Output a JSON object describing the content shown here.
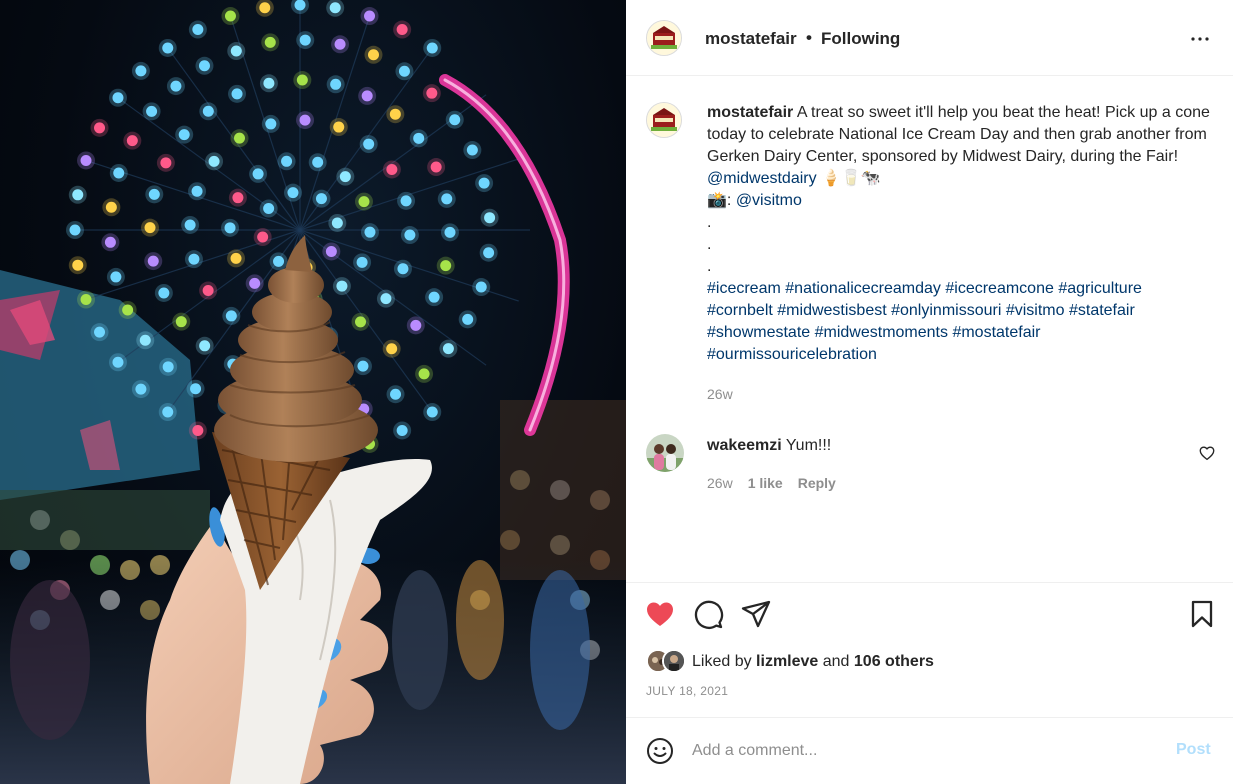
{
  "post": {
    "username": "mostatefair",
    "header_separator": "•",
    "follow_status": "Following",
    "logo_text": "MISSOURI STATE FAIR"
  },
  "caption": {
    "username": "mostatefair",
    "text_1": " A treat so sweet it'll help you beat the heat! Pick up a cone today to celebrate National Ice Cream Day and then grab another from Gerken Dairy Center, sponsored by Midwest Dairy, during the Fair! ",
    "mention_1": "@midwestdairy",
    "emojis": " 🍦🥛🐄",
    "camera_prefix": "📸: ",
    "mention_2": "@visitmo",
    "dots": [
      ".",
      ".",
      "."
    ],
    "hashtags": [
      "#icecream",
      "#nationalicecreamday",
      "#icecreamcone",
      "#agriculture",
      "#cornbelt",
      "#midwestisbest",
      "#onlyinmissouri",
      "#visitmo",
      "#statefair",
      "#showmestate",
      "#midwestmoments",
      "#mostatefair",
      "#ourmissouricelebration"
    ],
    "time": "26w"
  },
  "comment": {
    "username": "wakeemzi",
    "text": " Yum!!!",
    "time": "26w",
    "likes": "1 like",
    "reply": "Reply"
  },
  "actions": {
    "liked_by_prefix": "Liked by ",
    "liked_by_user": "lizmleve",
    "liked_by_middle": " and ",
    "liked_by_others": "106 others",
    "date": "JULY 18, 2021",
    "heart_color": "#ed4956"
  },
  "comment_box": {
    "placeholder": "Add a comment...",
    "post_label": "Post",
    "post_color": "#b2dffc"
  },
  "colors": {
    "link": "#00376b",
    "muted": "#8e8e8e",
    "text": "#262626"
  }
}
